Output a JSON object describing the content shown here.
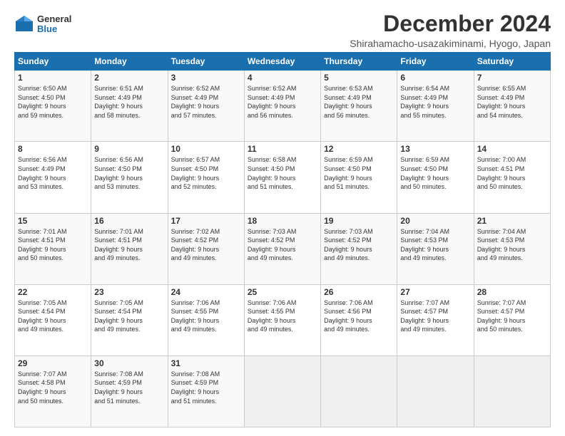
{
  "logo": {
    "general": "General",
    "blue": "Blue"
  },
  "title": "December 2024",
  "subtitle": "Shirahamacho-usazakiminami, Hyogo, Japan",
  "days": [
    "Sunday",
    "Monday",
    "Tuesday",
    "Wednesday",
    "Thursday",
    "Friday",
    "Saturday"
  ],
  "weeks": [
    [
      {
        "day": "1",
        "info": "Sunrise: 6:50 AM\nSunset: 4:50 PM\nDaylight: 9 hours\nand 59 minutes."
      },
      {
        "day": "2",
        "info": "Sunrise: 6:51 AM\nSunset: 4:49 PM\nDaylight: 9 hours\nand 58 minutes."
      },
      {
        "day": "3",
        "info": "Sunrise: 6:52 AM\nSunset: 4:49 PM\nDaylight: 9 hours\nand 57 minutes."
      },
      {
        "day": "4",
        "info": "Sunrise: 6:52 AM\nSunset: 4:49 PM\nDaylight: 9 hours\nand 56 minutes."
      },
      {
        "day": "5",
        "info": "Sunrise: 6:53 AM\nSunset: 4:49 PM\nDaylight: 9 hours\nand 56 minutes."
      },
      {
        "day": "6",
        "info": "Sunrise: 6:54 AM\nSunset: 4:49 PM\nDaylight: 9 hours\nand 55 minutes."
      },
      {
        "day": "7",
        "info": "Sunrise: 6:55 AM\nSunset: 4:49 PM\nDaylight: 9 hours\nand 54 minutes."
      }
    ],
    [
      {
        "day": "8",
        "info": "Sunrise: 6:56 AM\nSunset: 4:49 PM\nDaylight: 9 hours\nand 53 minutes."
      },
      {
        "day": "9",
        "info": "Sunrise: 6:56 AM\nSunset: 4:50 PM\nDaylight: 9 hours\nand 53 minutes."
      },
      {
        "day": "10",
        "info": "Sunrise: 6:57 AM\nSunset: 4:50 PM\nDaylight: 9 hours\nand 52 minutes."
      },
      {
        "day": "11",
        "info": "Sunrise: 6:58 AM\nSunset: 4:50 PM\nDaylight: 9 hours\nand 51 minutes."
      },
      {
        "day": "12",
        "info": "Sunrise: 6:59 AM\nSunset: 4:50 PM\nDaylight: 9 hours\nand 51 minutes."
      },
      {
        "day": "13",
        "info": "Sunrise: 6:59 AM\nSunset: 4:50 PM\nDaylight: 9 hours\nand 50 minutes."
      },
      {
        "day": "14",
        "info": "Sunrise: 7:00 AM\nSunset: 4:51 PM\nDaylight: 9 hours\nand 50 minutes."
      }
    ],
    [
      {
        "day": "15",
        "info": "Sunrise: 7:01 AM\nSunset: 4:51 PM\nDaylight: 9 hours\nand 50 minutes."
      },
      {
        "day": "16",
        "info": "Sunrise: 7:01 AM\nSunset: 4:51 PM\nDaylight: 9 hours\nand 49 minutes."
      },
      {
        "day": "17",
        "info": "Sunrise: 7:02 AM\nSunset: 4:52 PM\nDaylight: 9 hours\nand 49 minutes."
      },
      {
        "day": "18",
        "info": "Sunrise: 7:03 AM\nSunset: 4:52 PM\nDaylight: 9 hours\nand 49 minutes."
      },
      {
        "day": "19",
        "info": "Sunrise: 7:03 AM\nSunset: 4:52 PM\nDaylight: 9 hours\nand 49 minutes."
      },
      {
        "day": "20",
        "info": "Sunrise: 7:04 AM\nSunset: 4:53 PM\nDaylight: 9 hours\nand 49 minutes."
      },
      {
        "day": "21",
        "info": "Sunrise: 7:04 AM\nSunset: 4:53 PM\nDaylight: 9 hours\nand 49 minutes."
      }
    ],
    [
      {
        "day": "22",
        "info": "Sunrise: 7:05 AM\nSunset: 4:54 PM\nDaylight: 9 hours\nand 49 minutes."
      },
      {
        "day": "23",
        "info": "Sunrise: 7:05 AM\nSunset: 4:54 PM\nDaylight: 9 hours\nand 49 minutes."
      },
      {
        "day": "24",
        "info": "Sunrise: 7:06 AM\nSunset: 4:55 PM\nDaylight: 9 hours\nand 49 minutes."
      },
      {
        "day": "25",
        "info": "Sunrise: 7:06 AM\nSunset: 4:55 PM\nDaylight: 9 hours\nand 49 minutes."
      },
      {
        "day": "26",
        "info": "Sunrise: 7:06 AM\nSunset: 4:56 PM\nDaylight: 9 hours\nand 49 minutes."
      },
      {
        "day": "27",
        "info": "Sunrise: 7:07 AM\nSunset: 4:57 PM\nDaylight: 9 hours\nand 49 minutes."
      },
      {
        "day": "28",
        "info": "Sunrise: 7:07 AM\nSunset: 4:57 PM\nDaylight: 9 hours\nand 50 minutes."
      }
    ],
    [
      {
        "day": "29",
        "info": "Sunrise: 7:07 AM\nSunset: 4:58 PM\nDaylight: 9 hours\nand 50 minutes."
      },
      {
        "day": "30",
        "info": "Sunrise: 7:08 AM\nSunset: 4:59 PM\nDaylight: 9 hours\nand 51 minutes."
      },
      {
        "day": "31",
        "info": "Sunrise: 7:08 AM\nSunset: 4:59 PM\nDaylight: 9 hours\nand 51 minutes."
      },
      {
        "day": "",
        "info": ""
      },
      {
        "day": "",
        "info": ""
      },
      {
        "day": "",
        "info": ""
      },
      {
        "day": "",
        "info": ""
      }
    ]
  ]
}
